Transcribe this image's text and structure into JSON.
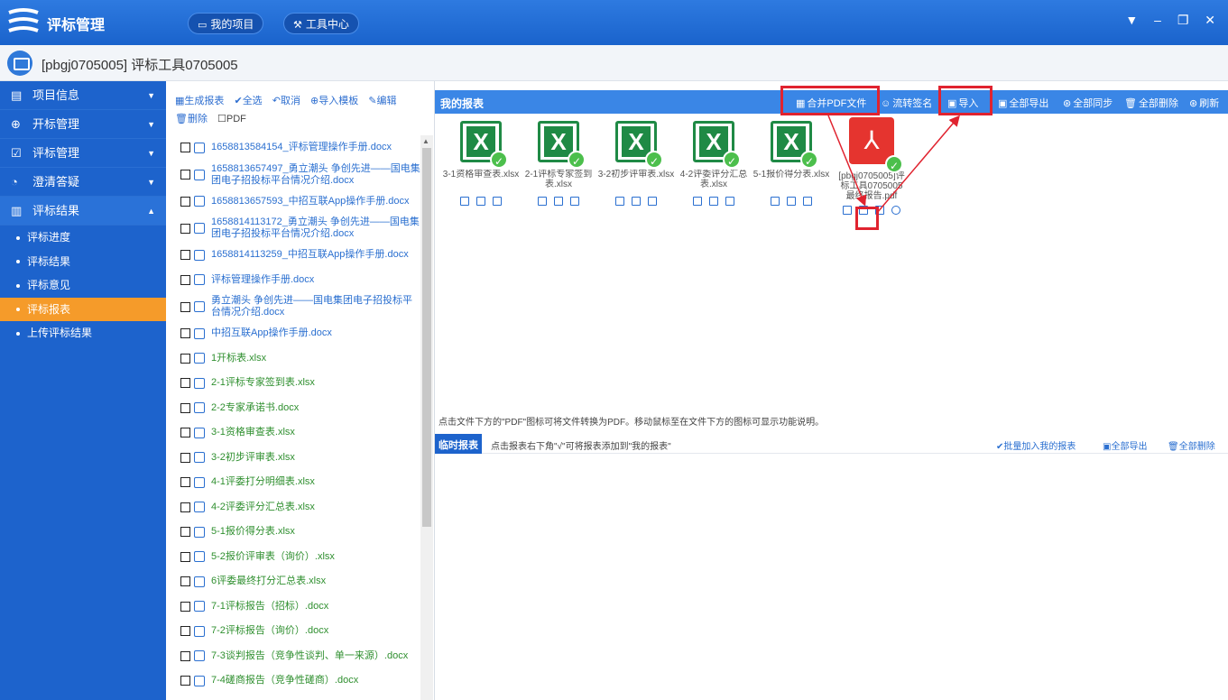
{
  "app": {
    "title": "评标管理",
    "nav": [
      {
        "icon": "monitor-icon",
        "label": "我的项目"
      },
      {
        "icon": "tools-icon",
        "label": "工具中心"
      }
    ],
    "window_controls": [
      "▼",
      "–",
      "❐",
      "✕"
    ]
  },
  "project": {
    "title": "[pbgj0705005] 评标工具0705005"
  },
  "sidebar": {
    "items": [
      {
        "icon": "info-icon",
        "label": "项目信息",
        "caret": "▼"
      },
      {
        "icon": "open-bid-icon",
        "label": "开标管理",
        "caret": "▼"
      },
      {
        "icon": "evaluate-icon",
        "label": "评标管理",
        "caret": "▼"
      },
      {
        "icon": "clarify-icon",
        "label": "澄清答疑",
        "caret": "▼"
      },
      {
        "icon": "chart-icon",
        "label": "评标结果",
        "caret": "▲"
      }
    ],
    "subitems": [
      {
        "label": "评标进度",
        "active": false
      },
      {
        "label": "评标结果",
        "active": false
      },
      {
        "label": "评标意见",
        "active": false
      },
      {
        "label": "评标报表",
        "active": true
      },
      {
        "label": "上传评标结果",
        "active": false
      }
    ]
  },
  "file_toolbar": {
    "generate": "生成报表",
    "select_all": "全选",
    "cancel": "取消",
    "import_template": "导入模板",
    "edit": "编辑",
    "delete": "删除",
    "pdf": "PDF"
  },
  "files": [
    {
      "name": "1658813584154_评标管理操作手册.docx",
      "color": "blue",
      "lines": 1
    },
    {
      "name": "1658813657497_勇立潮头 争创先进——国电集团电子招投标平台情况介绍.docx",
      "color": "blue",
      "lines": 2
    },
    {
      "name": "1658813657593_中招互联App操作手册.docx",
      "color": "blue",
      "lines": 1
    },
    {
      "name": "1658814113172_勇立潮头 争创先进——国电集团电子招投标平台情况介绍.docx",
      "color": "blue",
      "lines": 2
    },
    {
      "name": "1658814113259_中招互联App操作手册.docx",
      "color": "blue",
      "lines": 1
    },
    {
      "name": "评标管理操作手册.docx",
      "color": "blue",
      "lines": 1
    },
    {
      "name": "勇立潮头 争创先进——国电集团电子招投标平台情况介绍.docx",
      "color": "blue",
      "lines": 2
    },
    {
      "name": "中招互联App操作手册.docx",
      "color": "blue",
      "lines": 1
    },
    {
      "name": "1开标表.xlsx",
      "color": "green",
      "lines": 1
    },
    {
      "name": "2-1评标专家签到表.xlsx",
      "color": "green",
      "lines": 1
    },
    {
      "name": "2-2专家承诺书.docx",
      "color": "green",
      "lines": 1
    },
    {
      "name": "3-1资格审查表.xlsx",
      "color": "green",
      "lines": 1
    },
    {
      "name": "3-2初步评审表.xlsx",
      "color": "green",
      "lines": 1
    },
    {
      "name": "4-1评委打分明细表.xlsx",
      "color": "green",
      "lines": 1
    },
    {
      "name": "4-2评委评分汇总表.xlsx",
      "color": "green",
      "lines": 1
    },
    {
      "name": "5-1报价得分表.xlsx",
      "color": "green",
      "lines": 1
    },
    {
      "name": "5-2报价评审表（询价）.xlsx",
      "color": "green",
      "lines": 1
    },
    {
      "name": "6评委最终打分汇总表.xlsx",
      "color": "green",
      "lines": 1
    },
    {
      "name": "7-1评标报告（招标）.docx",
      "color": "green",
      "lines": 1
    },
    {
      "name": "7-2评标报告（询价）.docx",
      "color": "green",
      "lines": 1
    },
    {
      "name": "7-3谈判报告（竞争性谈判、单一来源）.docx",
      "color": "green",
      "lines": 1
    },
    {
      "name": "7-4磋商报告（竞争性磋商）.docx",
      "color": "green",
      "lines": 1
    }
  ],
  "reports": {
    "title": "我的报表",
    "actions": {
      "merge_pdf": "合并PDF文件",
      "flow_sign": "流转签名",
      "import": "导入",
      "export_all": "全部导出",
      "sync_all": "全部同步",
      "delete_all": "全部删除",
      "refresh": "刷新"
    },
    "cards": [
      {
        "type": "xlsx",
        "name": "3-1资格审查表.xlsx"
      },
      {
        "type": "xlsx",
        "name": "2-1评标专家签到表.xlsx"
      },
      {
        "type": "xlsx",
        "name": "3-2初步评审表.xlsx"
      },
      {
        "type": "xlsx",
        "name": "4-2评委评分汇总表.xlsx"
      },
      {
        "type": "xlsx",
        "name": "5-1报价得分表.xlsx"
      },
      {
        "type": "pdf",
        "name": "[pbgj0705005]评标工具0705005最终报告.pdf"
      }
    ],
    "hint": "点击文件下方的\"PDF\"图标可将文件转换为PDF。移动鼠标至在文件下方的图标可显示功能说明。"
  },
  "temp_reports": {
    "title": "临时报表",
    "desc": "点击报表右下角\"√\"可将报表添加到\"我的报表\"",
    "batch_add": "批量加入我的报表",
    "export_all": "全部导出",
    "delete_all": "全部删除"
  },
  "colors": {
    "brand_blue": "#1d63cc",
    "active_orange": "#f59b2a",
    "excel_green": "#1f8a45",
    "pdf_red": "#e5342f",
    "highlight_red": "#e0232f"
  }
}
